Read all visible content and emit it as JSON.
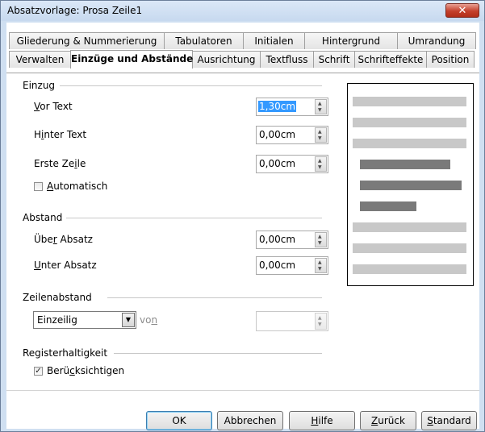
{
  "window": {
    "title": "Absatzvorlage: Prosa Zeile1",
    "close_label": "✕"
  },
  "tabs_top": [
    "Gliederung & Nummerierung",
    "Tabulatoren",
    "Initialen",
    "Hintergrund",
    "Umrandung"
  ],
  "tabs_bottom": [
    "Verwalten",
    "Einzüge und Abstände",
    "Ausrichtung",
    "Textfluss",
    "Schrift",
    "Schrifteffekte",
    "Position"
  ],
  "einzug": {
    "heading": "Einzug",
    "vor_text": {
      "label_pre": "",
      "accel": "V",
      "label_post": "or Text",
      "value": "1,30cm"
    },
    "hinter_text": {
      "label_pre": "H",
      "accel": "i",
      "label_post": "nter Text",
      "value": "0,00cm"
    },
    "erste_zeile": {
      "label_pre": "Erste Ze",
      "accel": "i",
      "label_post": "le",
      "value": "0,00cm"
    },
    "automatisch": {
      "label_pre": "",
      "accel": "A",
      "label_post": "utomatisch",
      "checked": false
    }
  },
  "abstand": {
    "heading": "Abstand",
    "ueber_absatz": {
      "label_pre": "Übe",
      "accel": "r",
      "label_post": " Absatz",
      "value": "0,00cm"
    },
    "unter_absatz": {
      "label_pre": "",
      "accel": "U",
      "label_post": "nter Absatz",
      "value": "0,00cm"
    }
  },
  "zeilenabstand": {
    "heading": "Zeilenabstand",
    "selected": "Einzeilig",
    "von_label_pre": "vo",
    "von_accel": "n",
    "von_value": ""
  },
  "register": {
    "heading": "Registerhaltigkeit",
    "label_pre": "Berü",
    "accel": "c",
    "label_post": "ksichtigen",
    "checked": true,
    "check_mark": "✓"
  },
  "buttons": {
    "ok": "OK",
    "abbrechen": "Abbrechen",
    "hilfe_accel": "H",
    "hilfe_post": "ilfe",
    "zurueck_accel": "Z",
    "zurueck_post": "urück",
    "standard_accel": "S",
    "standard_post": "tandard"
  },
  "colors": {
    "preview_light": "#c8c8c8",
    "preview_dark": "#7a7a7a",
    "selection": "#3399ff"
  }
}
